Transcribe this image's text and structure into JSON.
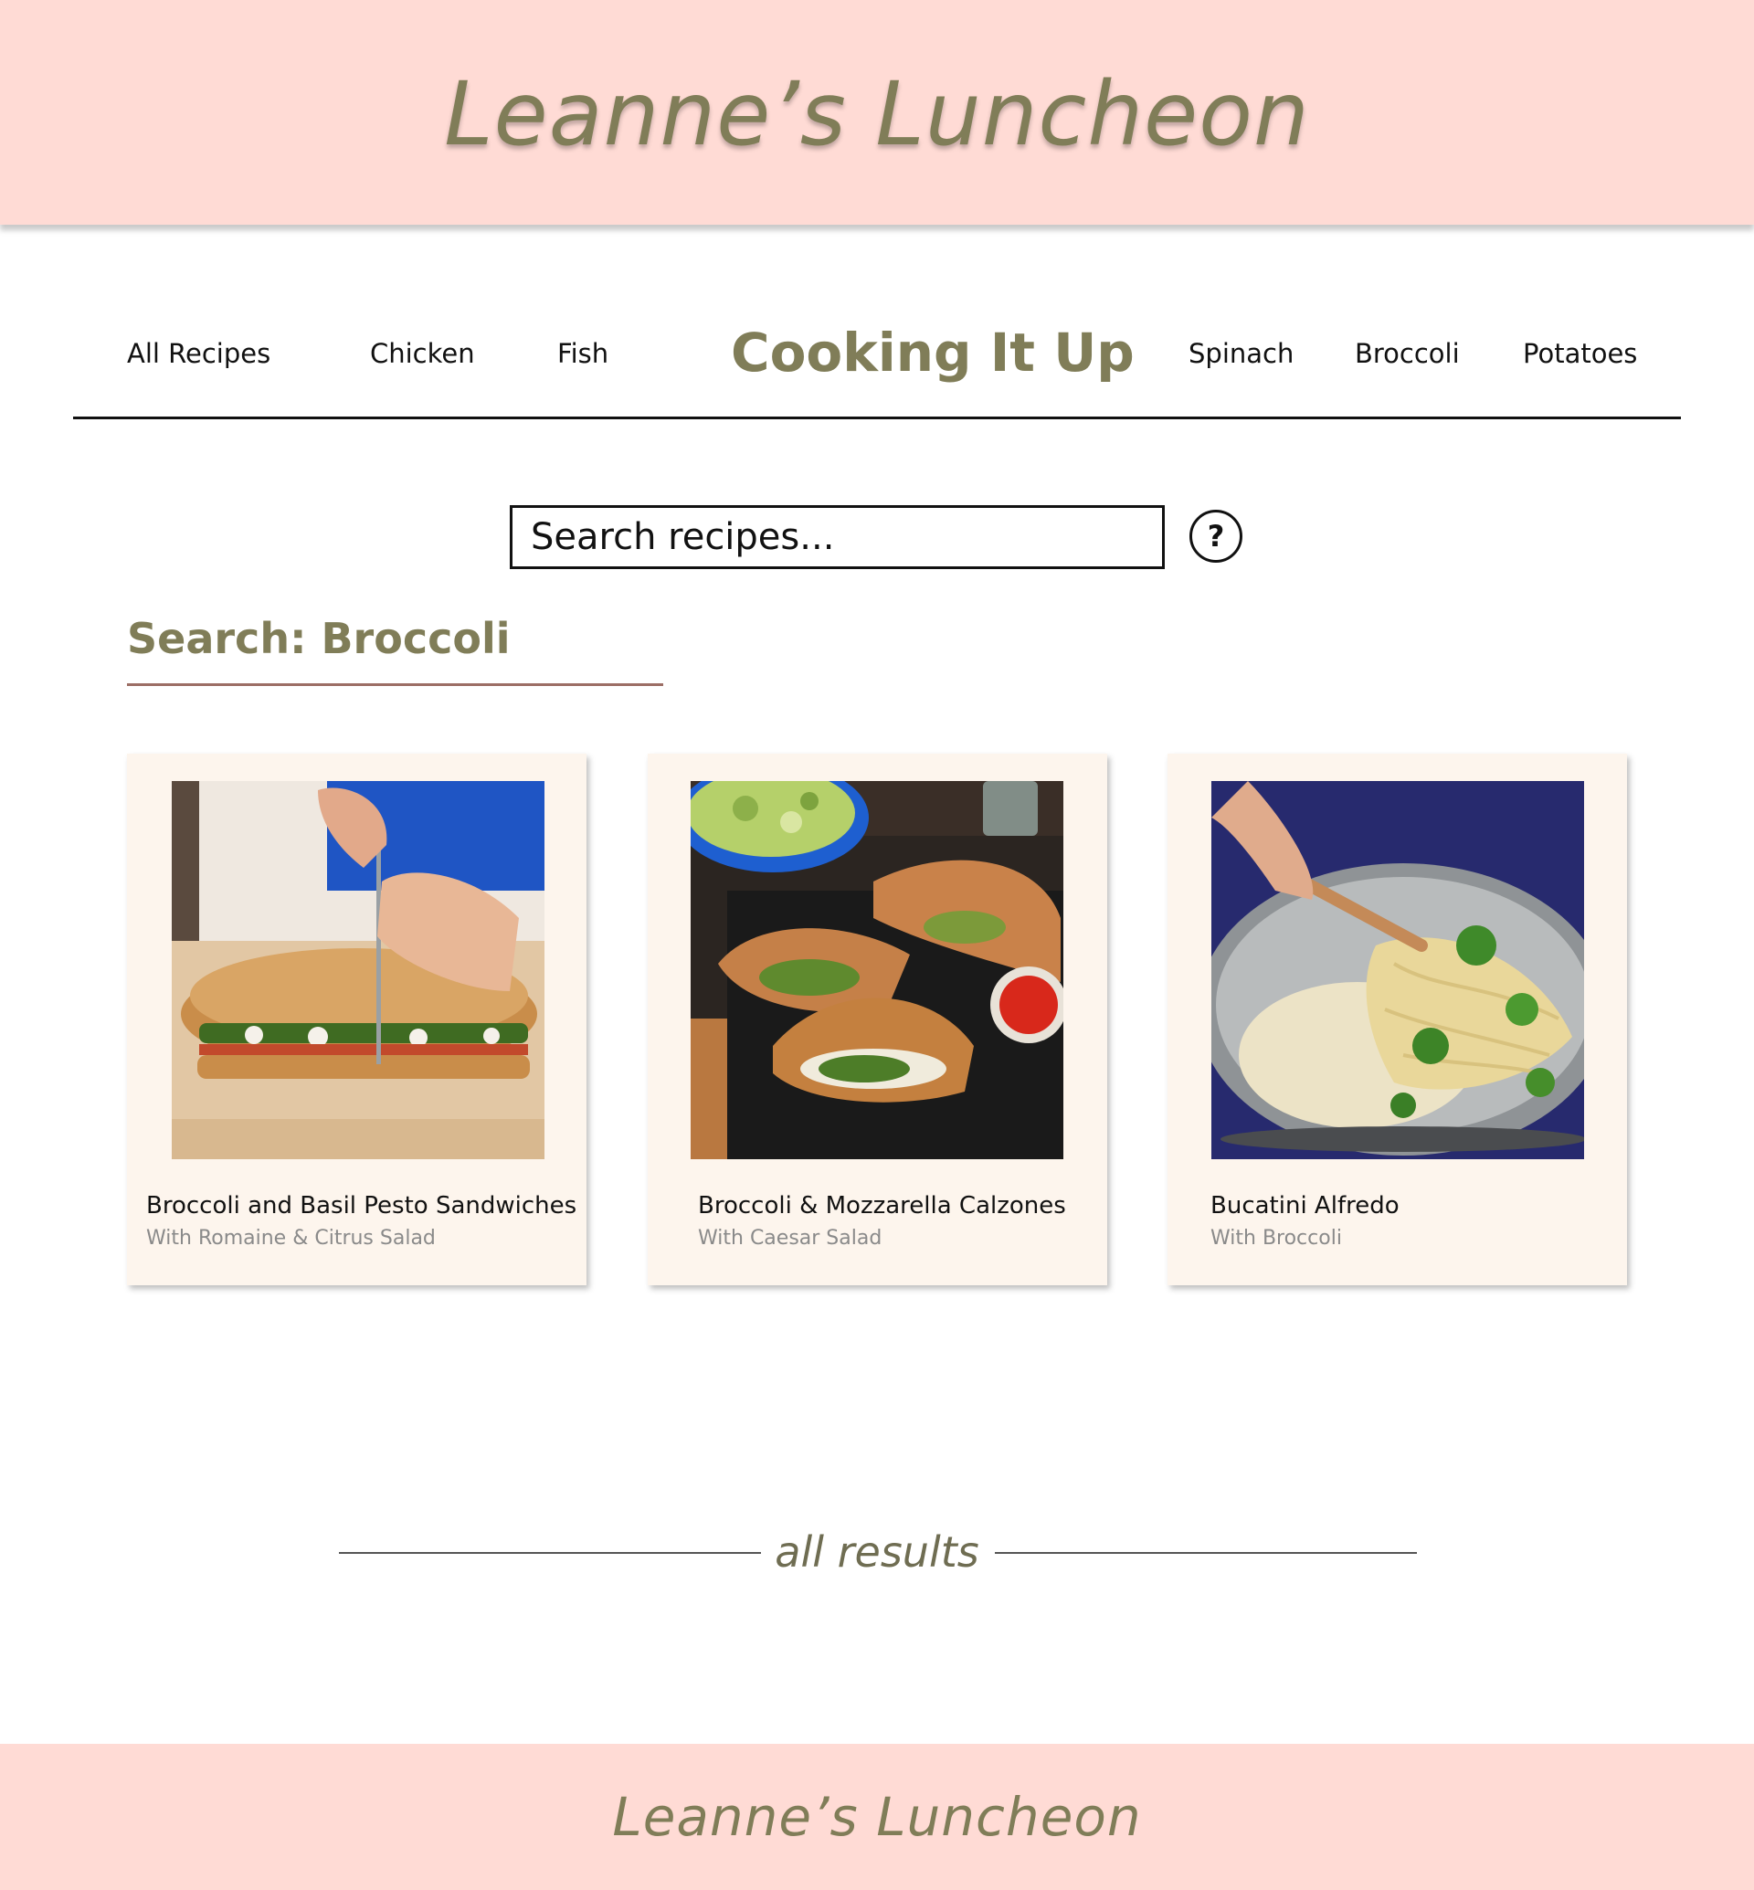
{
  "header": {
    "logo": "Leanne’s Luncheon"
  },
  "nav": {
    "links_left": [
      "All Recipes",
      "Chicken",
      "Fish"
    ],
    "brand": "Cooking It Up",
    "links_right": [
      "Spinach",
      "Broccoli",
      "Potatoes"
    ]
  },
  "search": {
    "placeholder": "Search recipes...",
    "help_label": "?",
    "heading": "Search: Broccoli"
  },
  "cards": [
    {
      "title": "Broccoli and Basil Pesto Sandwiches",
      "subtitle": "With Romaine & Citrus Salad"
    },
    {
      "title": "Broccoli & Mozzarella Calzones",
      "subtitle": "With Caesar Salad"
    },
    {
      "title": "Bucatini Alfredo",
      "subtitle": "With Broccoli"
    }
  ],
  "results": {
    "label": "all results"
  },
  "footer": {
    "logo": "Leanne’s Luncheon"
  },
  "colors": {
    "banner_pink": "#ffdbd5",
    "olive": "#807d58",
    "card_cream": "#fdf5ed",
    "search_underline": "#9c6e65"
  }
}
